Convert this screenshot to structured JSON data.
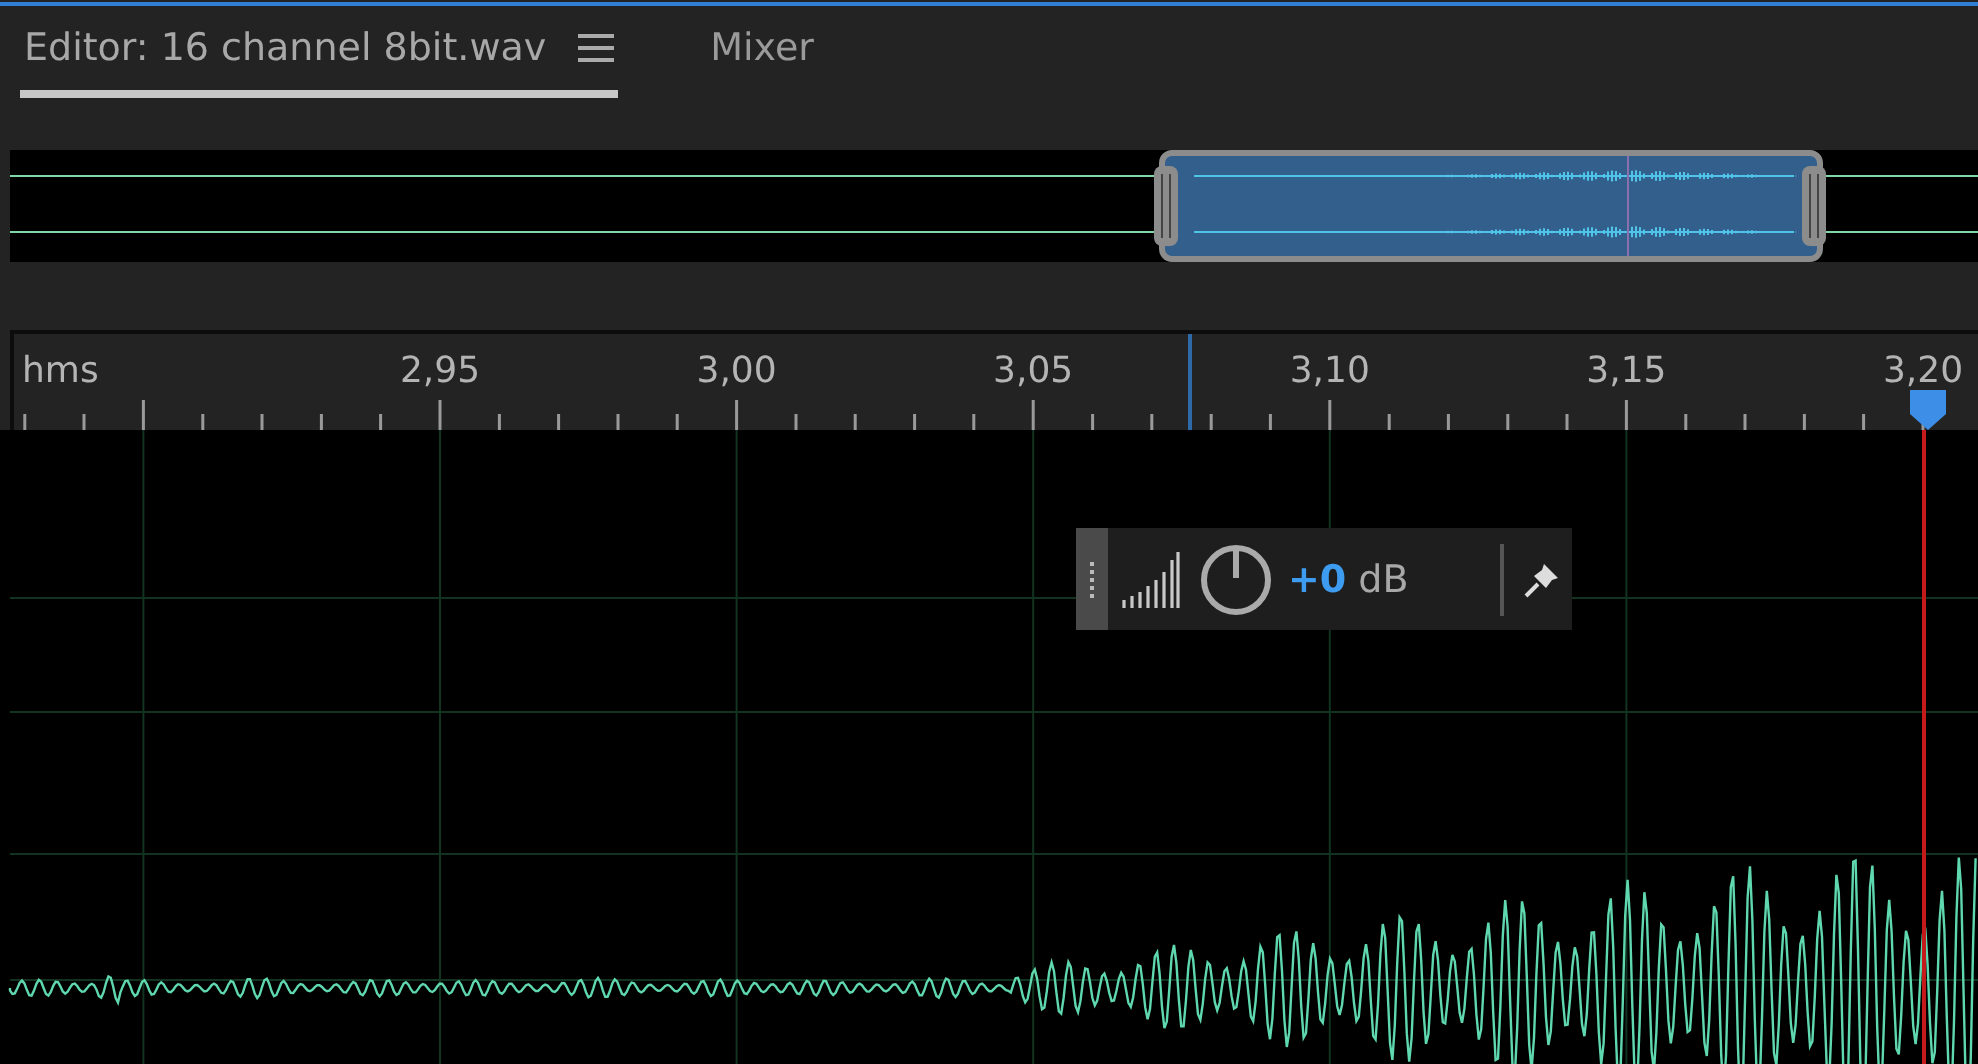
{
  "tabs": [
    {
      "label": "Editor: 16 channel 8bit.wav",
      "selected": true,
      "kind": "editor"
    },
    {
      "label": "Mixer",
      "selected": false,
      "kind": "plain"
    }
  ],
  "ruler": {
    "unit": "hms",
    "labels": [
      "2,95",
      "3,00",
      "3,05",
      "3,10",
      "3,15",
      "3,20"
    ]
  },
  "hud": {
    "gain": "+0",
    "unit": "dB"
  }
}
